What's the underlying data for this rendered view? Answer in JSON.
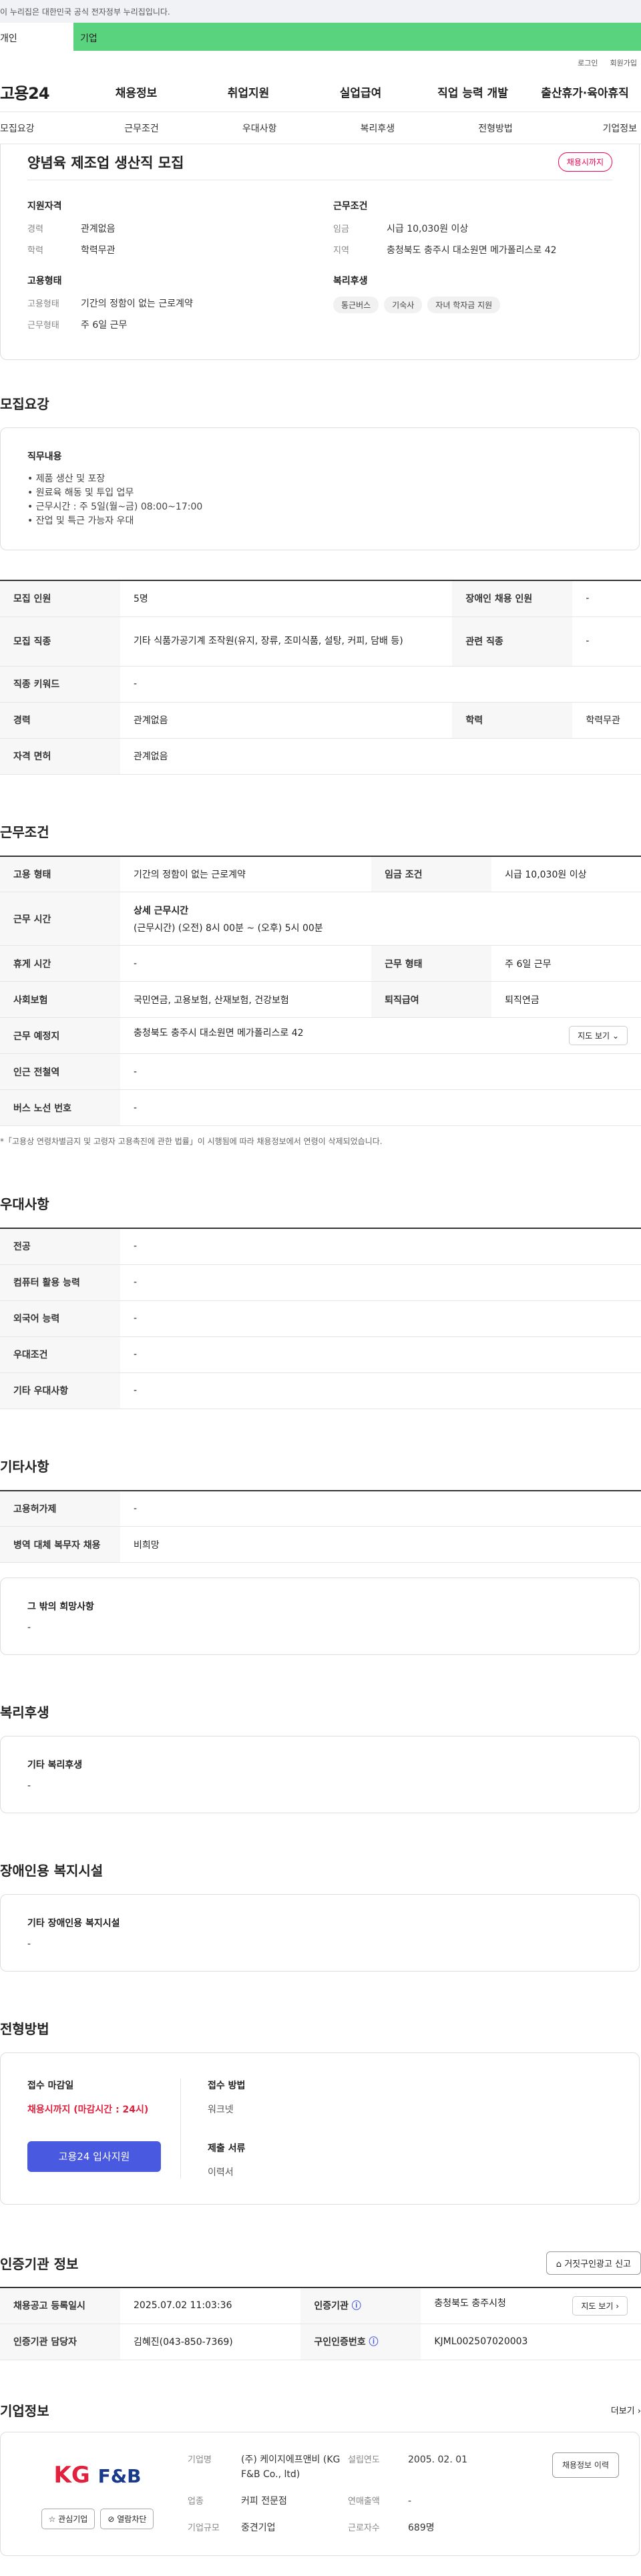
{
  "gov_banner": "이 누리집은 대한민국 공식 전자정부 누리집입니다.",
  "type_tabs": [
    "개인",
    "기업"
  ],
  "util": [
    "로그인",
    "회원가입"
  ],
  "logo": "고용24",
  "gnb": [
    "채용정보",
    "취업지원",
    "실업급여",
    "직업 능력 개발",
    "출산휴가·육아휴직"
  ],
  "subnav": [
    "모집요강",
    "근무조건",
    "우대사항",
    "복리후생",
    "전형방법",
    "기업정보"
  ],
  "summary": {
    "title": "양념육 제조업 생산직 모집",
    "badge": "채용시까지",
    "qual_title": "지원자격",
    "career_k": "경력",
    "career_v": "관계없음",
    "edu_k": "학력",
    "edu_v": "학력무관",
    "emp_title": "고용형태",
    "emptype_k": "고용형태",
    "emptype_v": "기간의 정함이 없는 근로계약",
    "worktype_k": "근무형태",
    "worktype_v": "주 6일 근무",
    "cond_title": "근무조건",
    "wage_k": "임금",
    "wage_v": "시급 10,030원 이상",
    "region_k": "지역",
    "region_v": "충청북도 충주시 대소원면 메가폴리스로 42",
    "welfare_title": "복리후생",
    "welfare_chips": [
      "통근버스",
      "기숙사",
      "자녀 학자금 지원"
    ]
  },
  "recruit": {
    "title": "모집요강",
    "duty_title": "직무내용",
    "duties": [
      "제품 생산 및 포장",
      "원료육 해동 및 투입 업무",
      "근무시간 : 주 5일(월~금) 08:00~17:00",
      "잔업 및 특근 가능자 우대"
    ],
    "rows": [
      [
        "모집 인원",
        "5명",
        "장애인 채용 인원",
        "-"
      ],
      [
        "모집 직종",
        "기타 식품가공기계 조작원(유지, 장류, 조미식품, 설탕, 커피, 담배 등)",
        "관련 직종",
        "-"
      ],
      [
        "직종 키워드",
        "-"
      ],
      [
        "경력",
        "관계없음",
        "학력",
        "학력무관"
      ],
      [
        "자격 면허",
        "관계없음"
      ]
    ]
  },
  "conditions": {
    "title": "근무조건",
    "emptype_k": "고용 형태",
    "emptype_v": "기간의 정함이 없는 근로계약",
    "wage_k": "임금 조건",
    "wage_v": "시급 10,030원 이상",
    "hours_k": "근무 시간",
    "hours_label": "상세 근무시간",
    "hours_v": "(근무시간) (오전) 8시 00분 ~ (오후) 5시 00분",
    "rest_k": "휴게 시간",
    "rest_v": "-",
    "worktype_k": "근무 형태",
    "worktype_v": "주 6일 근무",
    "ins_k": "사회보험",
    "ins_v": "국민연금, 고용보험, 산재보험, 건강보험",
    "sev_k": "퇴직급여",
    "sev_v": "퇴직연금",
    "place_k": "근무 예정지",
    "place_v": "충청북도 충주시 대소원면 메가폴리스로 42",
    "map_btn": "지도 보기",
    "station_k": "인근 전철역",
    "station_v": "-",
    "bus_k": "버스 노선 번호",
    "bus_v": "-",
    "note": "*「고용상 연령차별금지 및 고령자 고용촉진에 관한 법률」이 시행됨에 따라 채용정보에서 연령이 삭제되었습니다."
  },
  "prefer": {
    "title": "우대사항",
    "rows": [
      [
        "전공",
        "-"
      ],
      [
        "컴퓨터 활용 능력",
        "-"
      ],
      [
        "외국어 능력",
        "-"
      ],
      [
        "우대조건",
        "-"
      ],
      [
        "기타 우대사항",
        "-"
      ]
    ]
  },
  "etc": {
    "title": "기타사항",
    "rows": [
      [
        "고용허가제",
        "-"
      ],
      [
        "병역 대체 복무자 채용",
        "비희망"
      ]
    ],
    "hope_title": "그 밖의 희망사항",
    "hope_v": "-"
  },
  "welfare": {
    "title": "복리후생",
    "box_title": "기타 복리후생",
    "box_v": "-"
  },
  "disabled": {
    "title": "장애인용 복지시설",
    "box_title": "기타 장애인용 복지시설",
    "box_v": "-"
  },
  "selection": {
    "title": "전형방법",
    "deadline_label": "접수 마감일",
    "deadline_v": "채용시까지 (마감시간 : 24시)",
    "apply_btn": "고용24 입사지원",
    "method_label": "접수 방법",
    "method_v": "워크넷",
    "docs_label": "제출 서류",
    "docs_v": "이력서"
  },
  "cert": {
    "title": "인증기관 정보",
    "report_btn": "거짓구인광고 신고",
    "reg_k": "채용공고 등록일시",
    "reg_v": "2025.07.02 11:03:36",
    "org_k": "인증기관",
    "org_v": "충청북도 충주시청",
    "map_btn": "지도 보기",
    "mgr_k": "인증기관 담당자",
    "mgr_v": "김혜진(043-850-7369)",
    "num_k": "구인인증번호",
    "num_v": "KJML002507020003"
  },
  "company": {
    "title": "기업정보",
    "more": "더보기",
    "logo_kg": "KG",
    "logo_fb": "F&B",
    "fav_btn": "관심기업",
    "block_btn": "열람차단",
    "name_k": "기업명",
    "name_v": "(주) 케이지에프앤비 (KG F&B Co., ltd)",
    "est_k": "설립연도",
    "est_v": "2005. 02. 01",
    "jobs_btn": "채용정보 이력",
    "ind_k": "업종",
    "ind_v": "커피 전문점",
    "sales_k": "연매출액",
    "sales_v": "-",
    "emp_k": "근로자수",
    "emp_v": "689명",
    "size_k": "기업규모",
    "size_v": "중견기업"
  }
}
